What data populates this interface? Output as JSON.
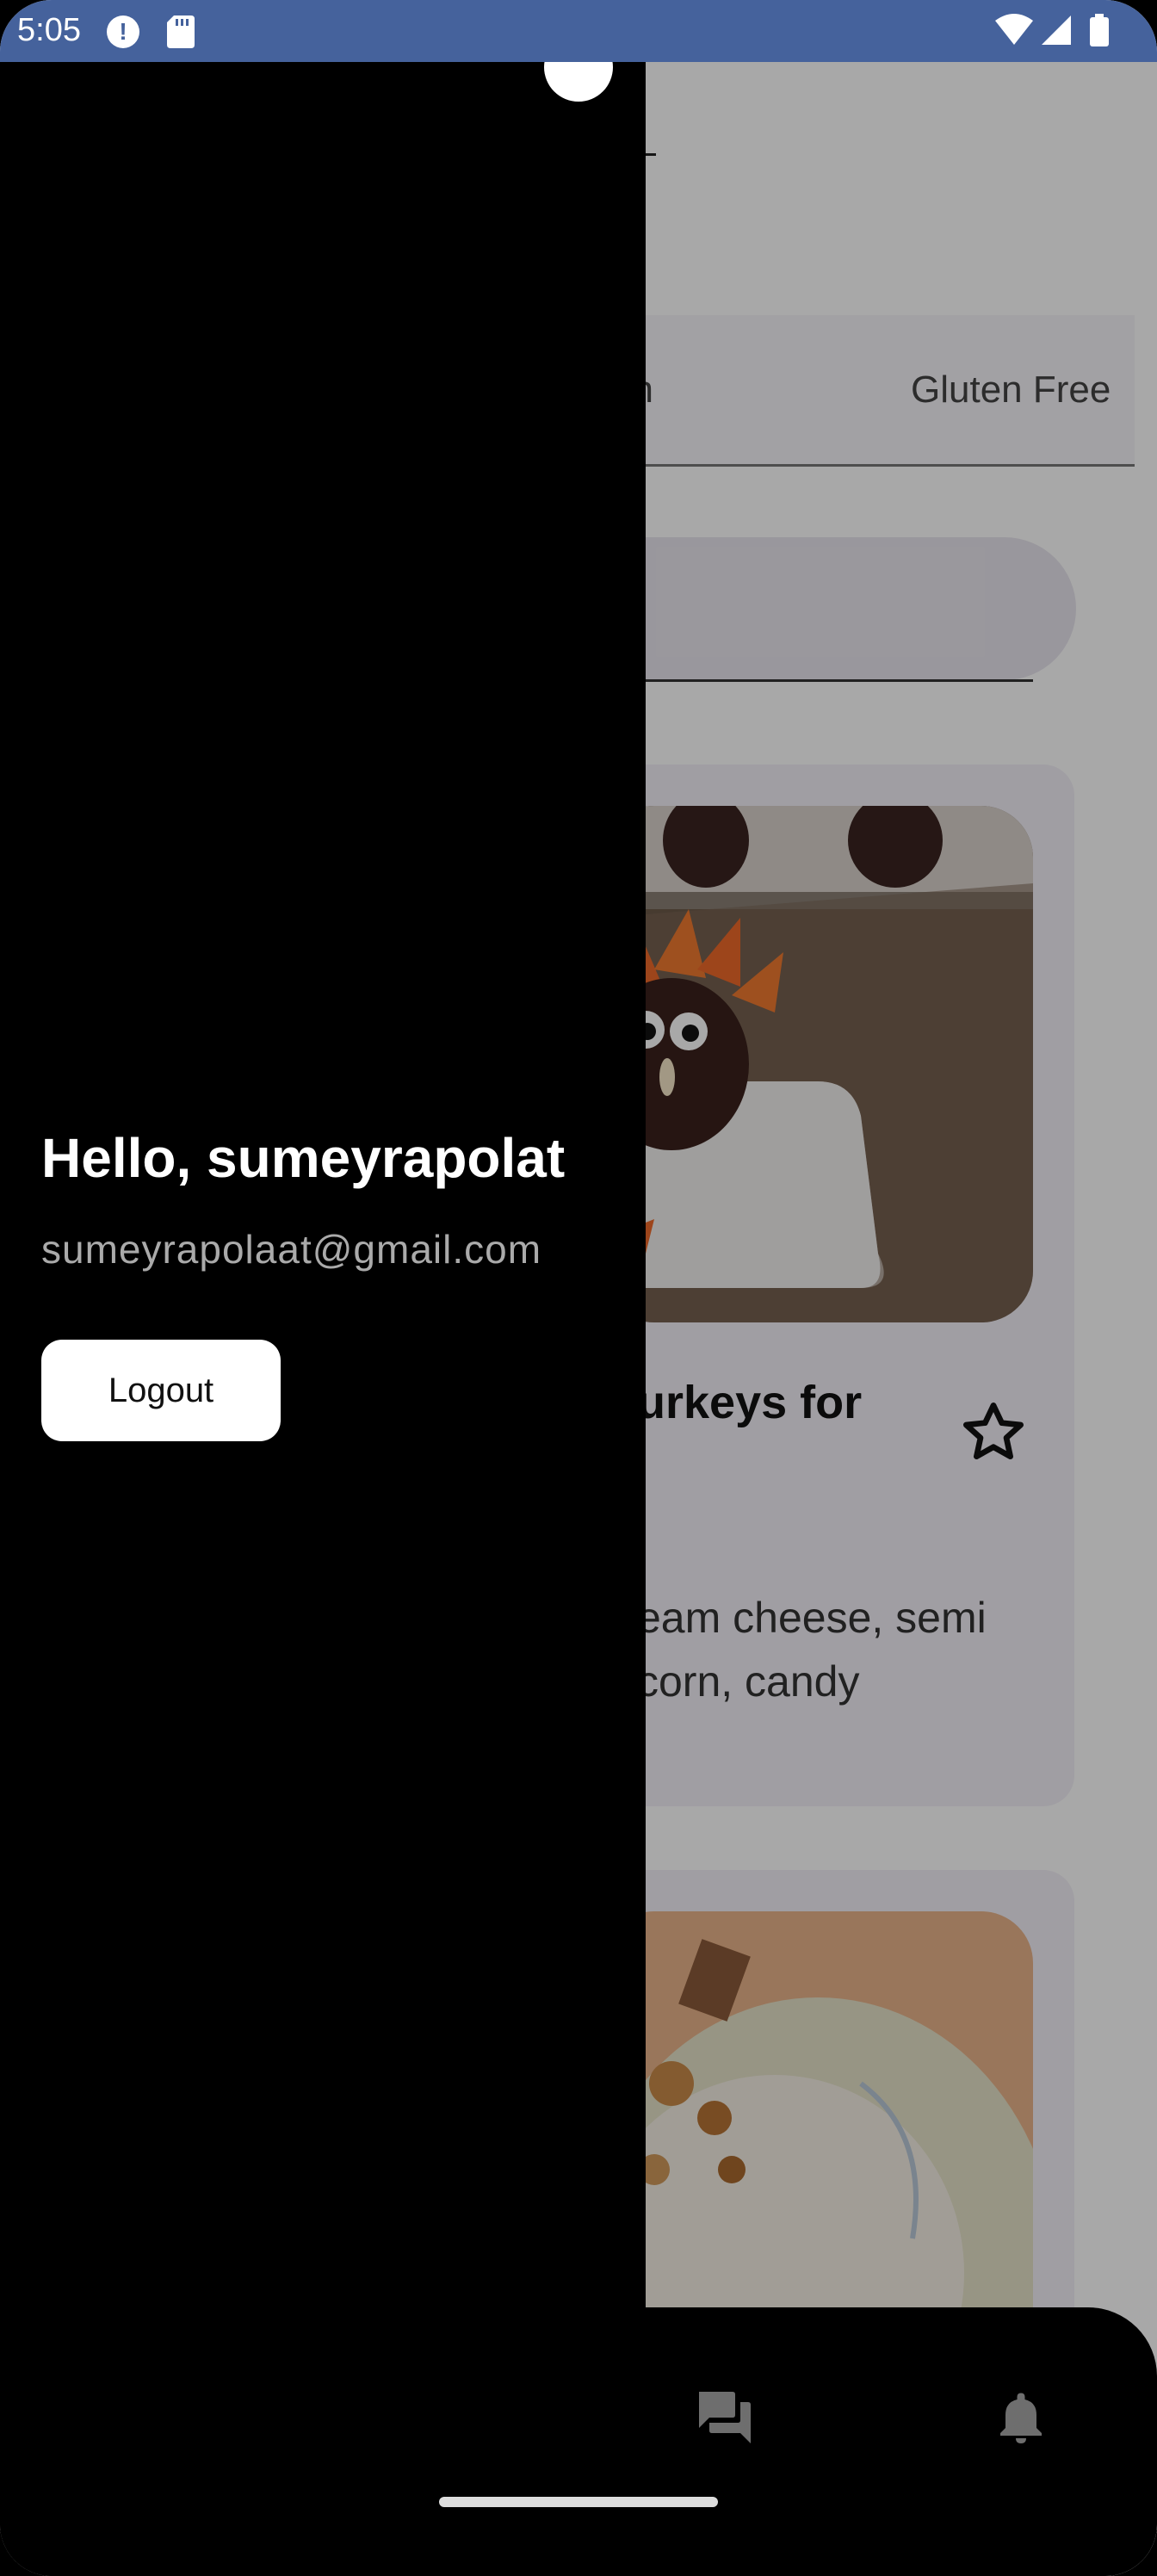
{
  "status_bar": {
    "time": "5:05",
    "icons": [
      "alert-icon",
      "sd-card-icon",
      "wifi-icon",
      "signal-icon",
      "battery-icon"
    ]
  },
  "tabs": {
    "items": [
      "getarian",
      "Gluten Free"
    ]
  },
  "drawer": {
    "greeting": "Hello, sumeyrapolat",
    "email": "sumeyrapolaat@gmail.com",
    "logout_label": "Logout"
  },
  "recipe_card": {
    "title_fragment": "urkeys for",
    "description_line1": "eam cheese, semi",
    "description_line2": "corn, candy",
    "favorite_icon": "star-outline-icon"
  },
  "bottom_nav": {
    "icons": [
      "chat-icon",
      "bell-icon"
    ]
  },
  "colors": {
    "status_bar": "#45629c",
    "drawer_bg": "#000000",
    "scrim": "rgba(0,0,0,0.34)"
  }
}
